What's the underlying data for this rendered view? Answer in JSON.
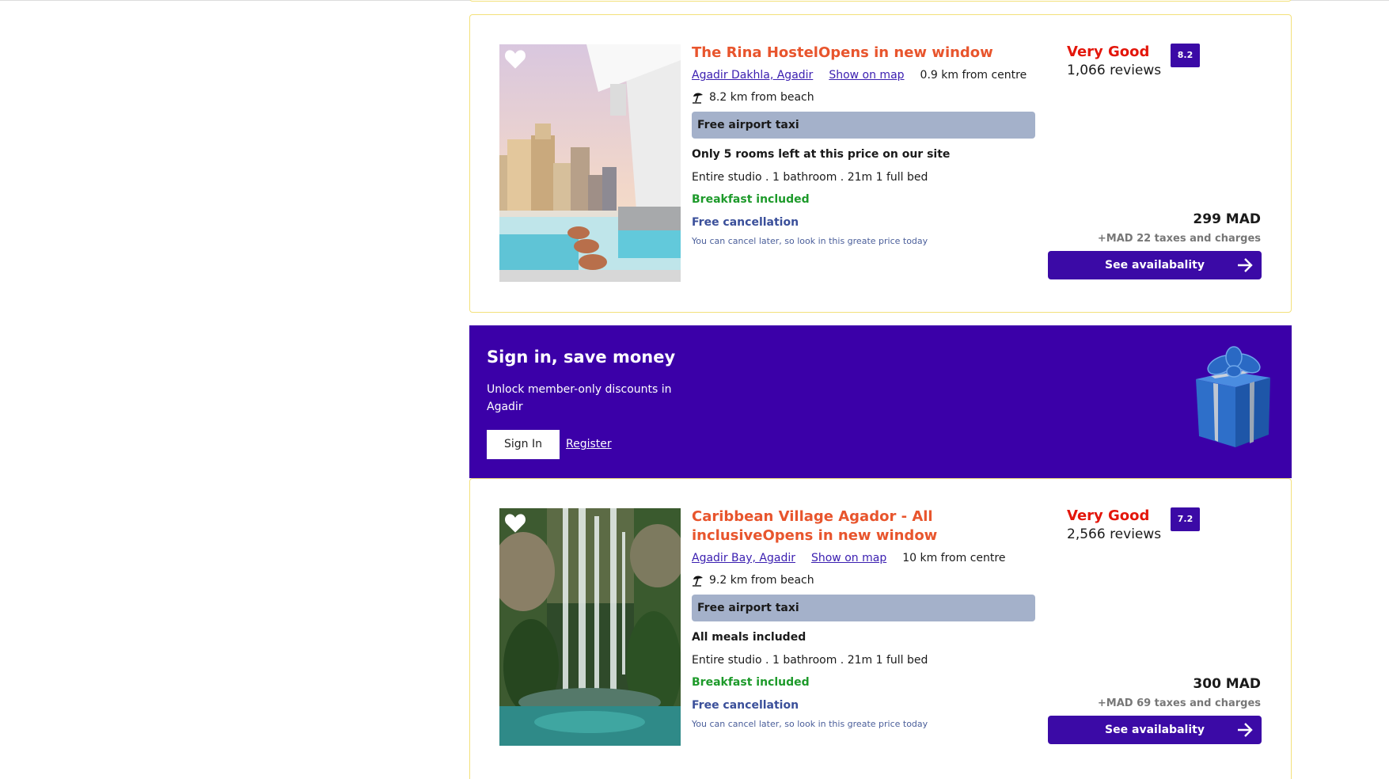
{
  "listings": [
    {
      "title": "The Rina HostelOpens in new window",
      "area_link": "Agadir Dakhla, Agadir",
      "map_link": "Show on map",
      "distance_centre": "0.9 km from centre",
      "distance_beach": "8.2 km from beach",
      "badge": "Free airport taxi",
      "highlight": "Only 5 rooms left at this price on our site",
      "room": "Entire studio . 1 bathroom . 21m 1 full bed",
      "breakfast": "Breakfast included",
      "cancellation": "Free cancellation",
      "cancellation_note": "You can cancel later, so look in this greate price today",
      "rating_word": "Very Good",
      "reviews": "1,066 reviews",
      "score": "8.2",
      "price": "299 MAD",
      "taxes": "+MAD 22 taxes and charges",
      "button": "See availabality",
      "photo_icon": "heart-icon"
    },
    {
      "title": "Caribbean Village Agador - All inclusiveOpens in new window",
      "area_link": "Agadir Bay, Agadir",
      "map_link": "Show on map",
      "distance_centre": "10 km from centre",
      "distance_beach": "9.2 km from beach",
      "badge": "Free airport taxi",
      "highlight": "All meals included",
      "room": "Entire studio . 1 bathroom . 21m 1 full bed",
      "breakfast": "Breakfast included",
      "cancellation": "Free cancellation",
      "cancellation_note": "You can cancel later, so look in this greate price today",
      "rating_word": "Very Good",
      "reviews": "2,566 reviews",
      "score": "7.2",
      "price": "300 MAD",
      "taxes": "+MAD 69 taxes and charges",
      "button": "See availabality",
      "photo_icon": "heart-icon"
    }
  ],
  "banner": {
    "title": "Sign in, save money",
    "text": "Unlock member-only discounts in Agadir",
    "signin": "Sign In",
    "register": "Register",
    "icon": "gift-icon"
  },
  "colors": {
    "accent": "#3b0aa6",
    "title": "#e8552d",
    "rating": "#e3160b",
    "breakfast": "#1d9a2a",
    "card_border": "#f3e17a"
  }
}
